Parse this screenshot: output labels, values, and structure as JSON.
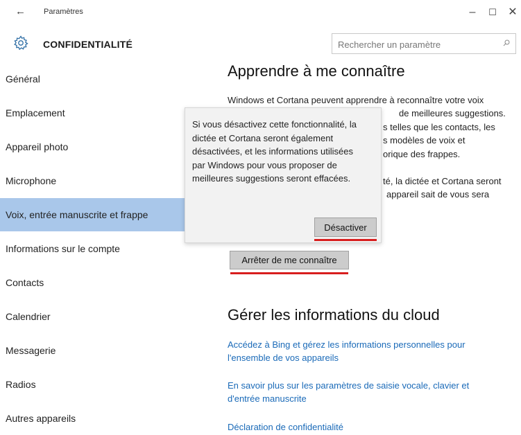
{
  "window": {
    "title": "Paramètres",
    "back_icon": "arrow-left-icon",
    "minimize_label": "–",
    "maximize_label": "☐",
    "close_label": "✕"
  },
  "header": {
    "icon": "gear-icon",
    "section_title": "CONFIDENTIALITÉ",
    "search_placeholder": "Rechercher un paramètre"
  },
  "sidebar": {
    "items": [
      {
        "label": "Général",
        "selected": false
      },
      {
        "label": "Emplacement",
        "selected": false
      },
      {
        "label": "Appareil photo",
        "selected": false
      },
      {
        "label": "Microphone",
        "selected": false
      },
      {
        "label": "Voix, entrée manuscrite et frappe",
        "selected": true
      },
      {
        "label": "Informations sur le compte",
        "selected": false
      },
      {
        "label": "Contacts",
        "selected": false
      },
      {
        "label": "Calendrier",
        "selected": false
      },
      {
        "label": "Messagerie",
        "selected": false
      },
      {
        "label": "Radios",
        "selected": false
      },
      {
        "label": "Autres appareils",
        "selected": false
      }
    ]
  },
  "main": {
    "section1": {
      "heading": "Apprendre à me connaître",
      "lines": [
        "Windows et Cortana peuvent apprendre à reconnaître votre voix",
        "de meilleures suggestions.",
        "s telles que les contacts, les",
        "s modèles de voix et",
        "orique des frappes.",
        "té, la dictée et Cortana seront",
        "appareil sait de vous sera"
      ],
      "button_label": "Arrêter de me connaître"
    },
    "section2": {
      "heading": "Gérer les informations du cloud",
      "links": [
        [
          "Accédez à Bing et gérez les informations personnelles pour",
          "l'ensemble de vos appareils"
        ],
        [
          "En savoir plus sur les paramètres de saisie vocale, clavier et",
          "d'entrée manuscrite"
        ],
        [
          "Déclaration de confidentialité"
        ]
      ]
    }
  },
  "popup": {
    "lines": [
      "Si vous désactivez cette fonctionnalité, la",
      "dictée et Cortana seront également",
      "désactivées, et les informations utilisées",
      "par Windows pour vous proposer de",
      "meilleures suggestions seront effacées."
    ],
    "button_label": "Désactiver"
  },
  "colors": {
    "selected_bg": "#a9c7ea",
    "link": "#1a6ab8",
    "underline_accent": "#d81e1e",
    "button_bg": "#cccccc"
  }
}
